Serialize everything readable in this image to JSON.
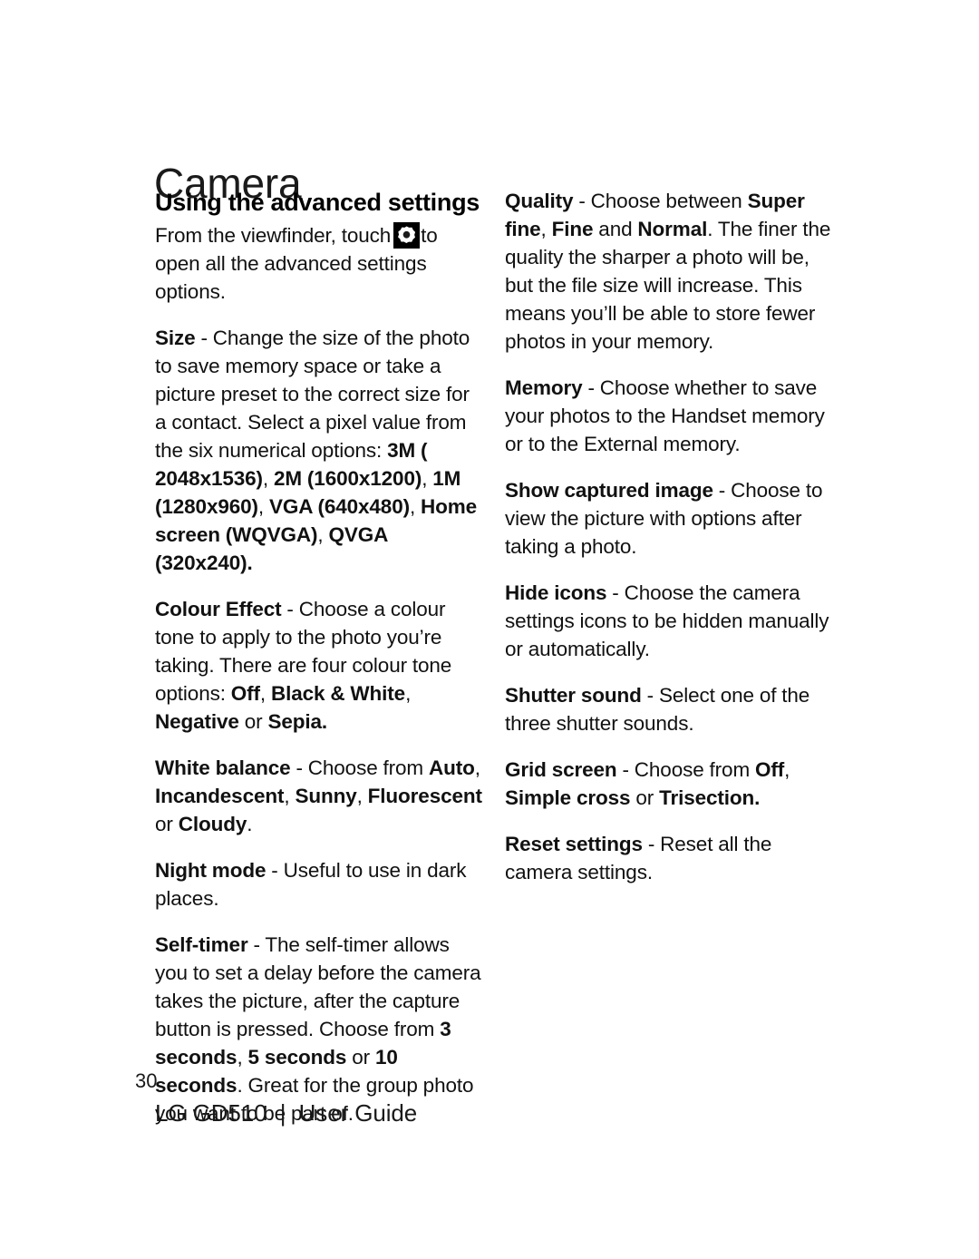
{
  "document": {
    "page_title": "Camera",
    "page_number": "30",
    "footer_guide": "LG GD510  |  User Guide"
  },
  "left_column": {
    "heading": "Using the advanced settings",
    "intro": {
      "before_icon": "From the viewfinder, touch",
      "icon": "gear-settings-icon",
      "after_icon": "to open all the advanced settings options."
    },
    "size": {
      "term": "Size",
      "body_1": " - Change the size of the photo to save memory space or take a picture preset to the correct size for a contact. Select a pixel value from the six numerical options: ",
      "opt_1": "3M ( 2048x1536)",
      "sep_1": ", ",
      "opt_2": "2M (1600x1200)",
      "sep_2": ", ",
      "opt_3": "1M (1280x960)",
      "sep_3": ", ",
      "opt_4": "VGA (640x480)",
      "sep_4": ", ",
      "opt_5": "Home screen (WQVGA)",
      "sep_5": ", ",
      "opt_6": "QVGA (320x240)",
      "end": "."
    },
    "colour_effect": {
      "term": "Colour Effect",
      "body_1": " - Choose a colour tone to apply to the photo you’re taking. There are four colour tone options: ",
      "opt_1": "Off",
      "sep_1": ", ",
      "opt_2": "Black & White",
      "sep_2": ", ",
      "opt_3": "Negative",
      "sep_3": " or ",
      "opt_4": "Sepia",
      "end": "."
    },
    "white_balance": {
      "term": "White balance",
      "body_1": " - Choose from ",
      "opt_1": "Auto",
      "sep_1": ", ",
      "opt_2": "Incandescent",
      "sep_2": ", ",
      "opt_3": "Sunny",
      "sep_3": ", ",
      "opt_4": "Fluorescent",
      "sep_4": " or ",
      "opt_5": "Cloudy",
      "end": "."
    },
    "night_mode": {
      "term": "Night mode",
      "body": " - Useful to use in dark places."
    },
    "self_timer": {
      "term": "Self-timer",
      "body_1": " - The self-timer allows you to set a delay before the camera takes the picture, after the capture button is pressed. Choose from ",
      "opt_1": "3 seconds",
      "sep_1": ", ",
      "opt_2": "5 seconds",
      "sep_2": " or ",
      "opt_3": "10 seconds",
      "body_2": ". Great for the group photo you want to be part of."
    }
  },
  "right_column": {
    "quality": {
      "term": "Quality ",
      "body_1": " - Choose between ",
      "opt_1": "Super fine",
      "sep_1": ", ",
      "opt_2": "Fine",
      "sep_2": " and ",
      "opt_3": "Normal",
      "body_2": ". The finer the quality the sharper a photo will be, but the file size will increase. This means you’ll be able to store fewer photos in your memory."
    },
    "memory": {
      "term": "Memory",
      "body": " - Choose whether to save your photos to the Handset memory or to the External memory."
    },
    "show_captured_image": {
      "term": "Show captured image",
      "body": " - Choose to view the picture with options after taking a photo."
    },
    "hide_icons": {
      "term": "Hide icons",
      "body": " - Choose the camera settings icons to be hidden manually or automatically."
    },
    "shutter_sound": {
      "term": "Shutter sound",
      "body": " - Select one of the three shutter sounds."
    },
    "grid_screen": {
      "term": "Grid screen",
      "body_1": " - Choose from ",
      "opt_1": "Off",
      "sep_1": ", ",
      "opt_2": "Simple cross",
      "sep_2": " or ",
      "opt_3": "Trisection",
      "end": "."
    },
    "reset_settings": {
      "term": "Reset settings",
      "body": " - Reset all the camera settings."
    }
  }
}
